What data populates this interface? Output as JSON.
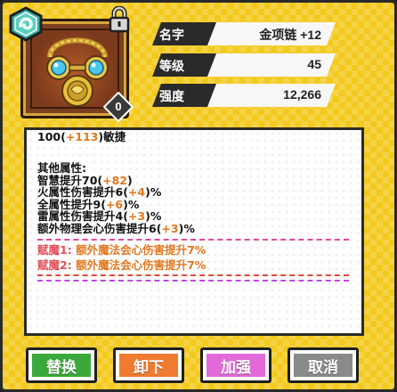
{
  "item": {
    "icon": "gold-amulet-icon",
    "type_badge": "ring-type-icon",
    "lock_icon": "lock-icon",
    "level": "0"
  },
  "stats": [
    {
      "label": "名字",
      "value": "金项链 +12"
    },
    {
      "label": "等级",
      "value": "45"
    },
    {
      "label": "强度",
      "value": "12,266"
    }
  ],
  "description": {
    "first_line": {
      "base": "100(",
      "bonus": "+113",
      "suffix": ")敏捷"
    },
    "other_header": "其他属性:",
    "attributes": [
      {
        "text": "智慧提升70",
        "bonus": "+82",
        "suffix": ""
      },
      {
        "text": "火属性伤害提升6",
        "bonus": "+4",
        "suffix": "%"
      },
      {
        "text": "全属性提升9",
        "bonus": "+6",
        "suffix": "%"
      },
      {
        "text": "雷属性伤害提升4",
        "bonus": "+3",
        "suffix": "%"
      },
      {
        "text": "额外物理会心伤害提升6",
        "bonus": "+3",
        "suffix": "%"
      }
    ],
    "enchants": [
      {
        "label": "赋魔1:",
        "text": "额外魔法会心伤害提升7%"
      },
      {
        "label": "赋魔2:",
        "text": "额外魔法会心伤害提升7%"
      }
    ]
  },
  "buttons": [
    {
      "label": "替换",
      "color": "#3aa83a"
    },
    {
      "label": "卸下",
      "color": "#f07a30"
    },
    {
      "label": "加强",
      "color": "#e26ad8"
    },
    {
      "label": "取消",
      "color": "#8a8a8a"
    }
  ],
  "colors": {
    "panel_bg": "#f3c91d",
    "bonus": "#e07820",
    "enchant_label": "#e0505a"
  }
}
